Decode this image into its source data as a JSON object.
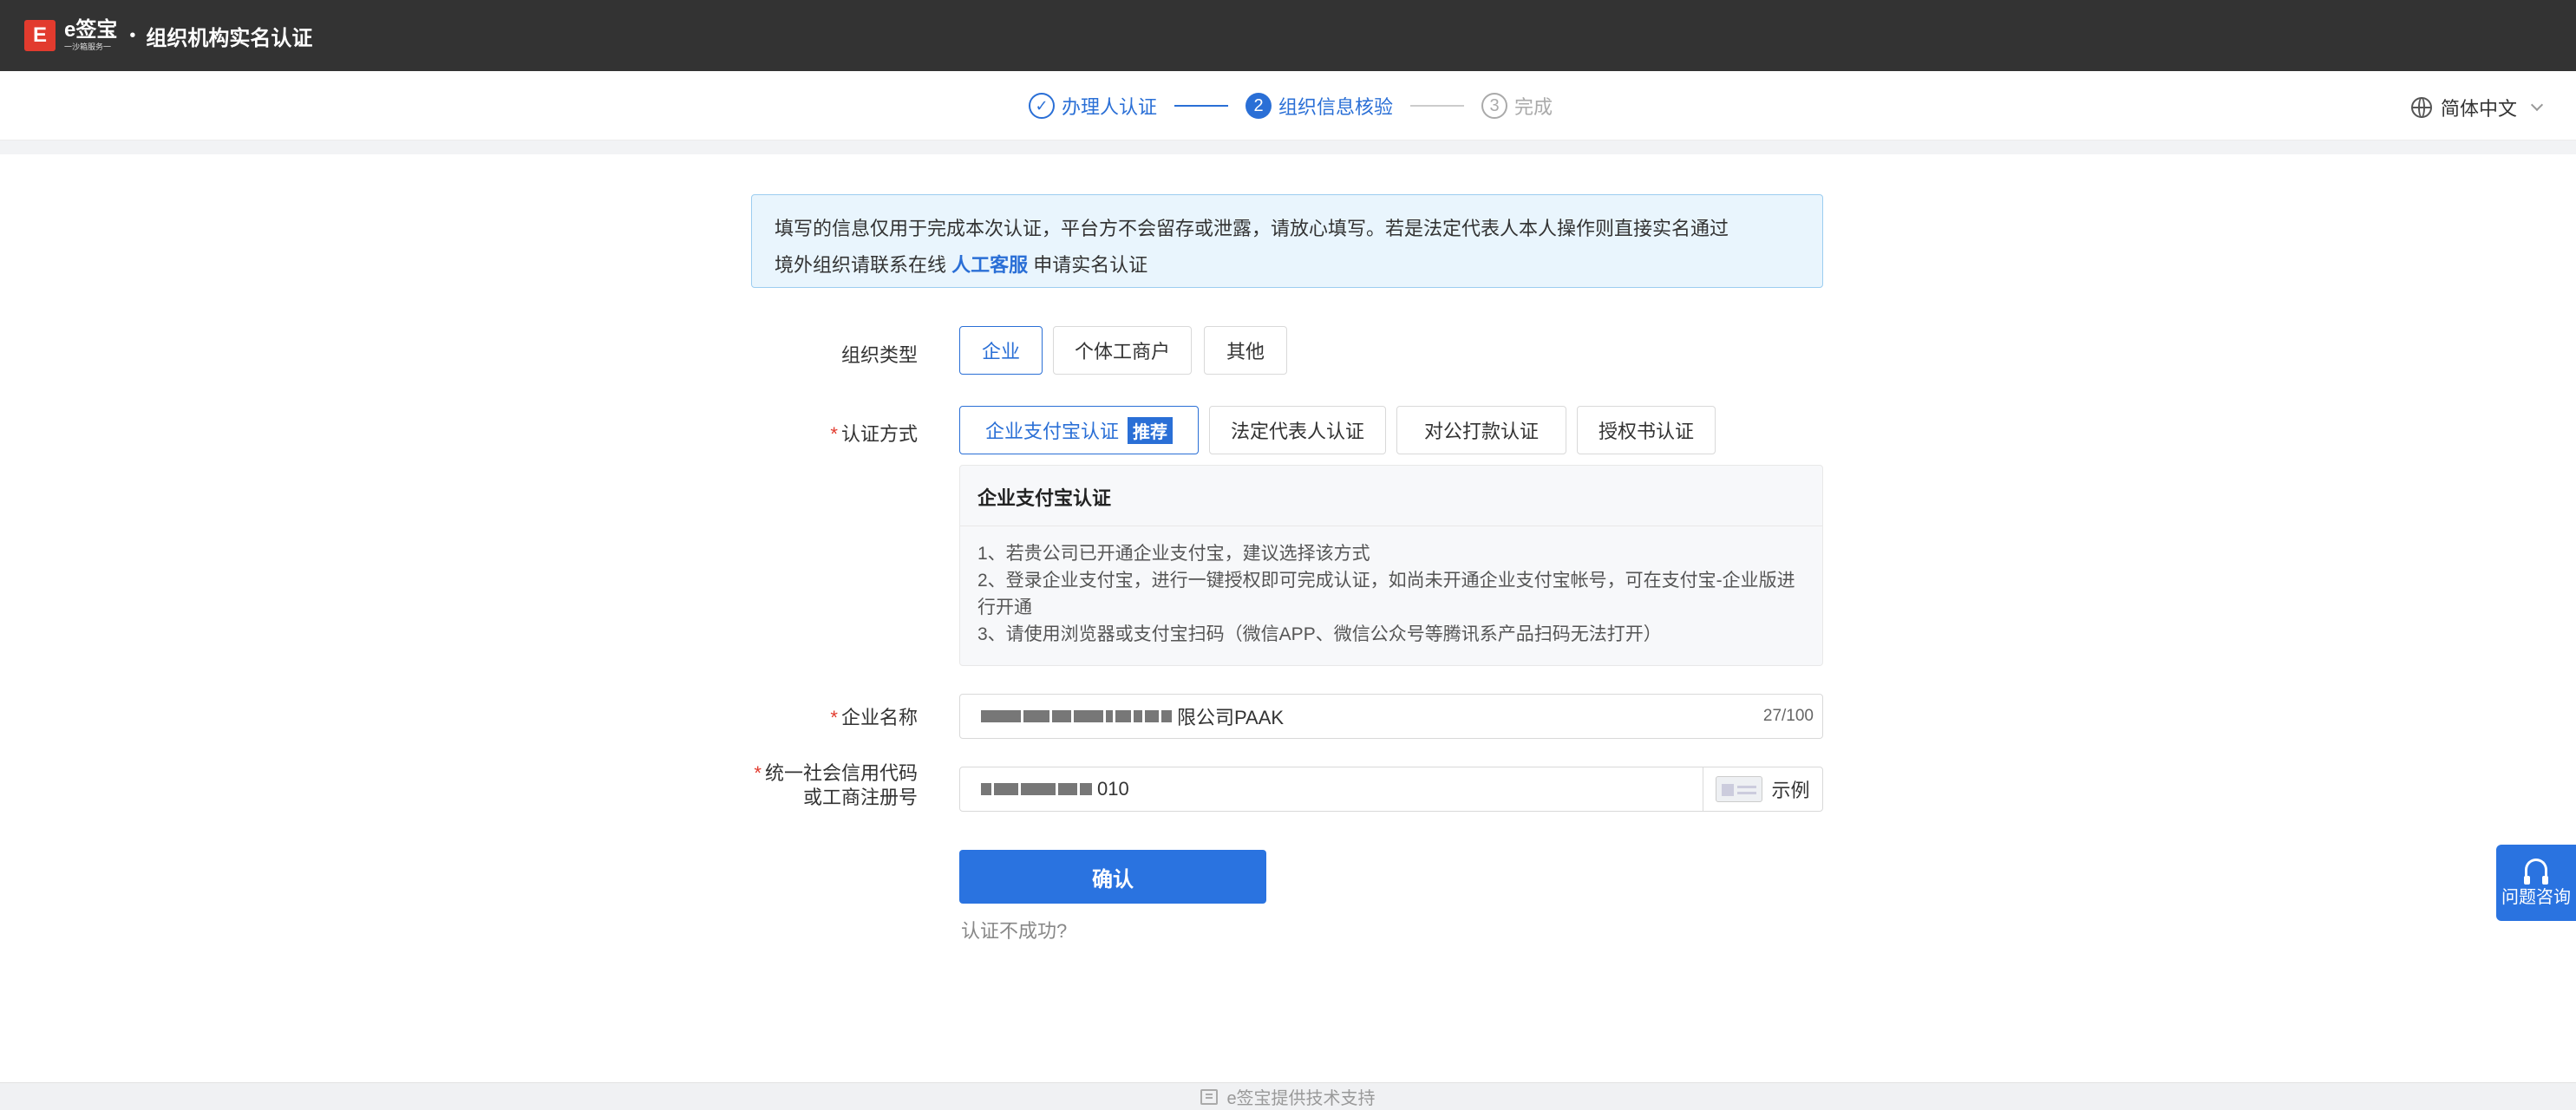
{
  "header": {
    "logo_mark": "E",
    "logo_name": "e签宝",
    "logo_sub": "一沙箱服务一",
    "separator": "•",
    "title": "组织机构实名认证"
  },
  "steps": [
    {
      "label": "办理人认证",
      "marker": "✓",
      "state": "done"
    },
    {
      "label": "组织信息核验",
      "marker": "2",
      "state": "active"
    },
    {
      "label": "完成",
      "marker": "3",
      "state": "todo"
    }
  ],
  "language": {
    "label": "简体中文"
  },
  "notice": {
    "line1": "填写的信息仅用于完成本次认证，平台方不会留存或泄露，请放心填写。若是法定代表人本人操作则直接实名通过",
    "line2_prefix": "境外组织请联系在线",
    "line2_link": "人工客服",
    "line2_suffix": "申请实名认证"
  },
  "org_type": {
    "label": "组织类型",
    "options": [
      "企业",
      "个体工商户",
      "其他"
    ],
    "selected": "企业"
  },
  "auth_method": {
    "label": "认证方式",
    "options": [
      "企业支付宝认证",
      "法定代表人认证",
      "对公打款认证",
      "授权书认证"
    ],
    "recommended_tag": "推荐",
    "selected": "企业支付宝认证"
  },
  "description": {
    "title": "企业支付宝认证",
    "lines": [
      "1、若贵公司已开通企业支付宝，建议选择该方式",
      "2、登录企业支付宝，进行一键授权即可完成认证，如尚未开通企业支付宝帐号，可在支付宝-企业版进行开通",
      "3、请使用浏览器或支付宝扫码（微信APP、微信公众号等腾讯系产品扫码无法打开）"
    ]
  },
  "company_name": {
    "label": "企业名称",
    "visible_value": "限公司PAAK",
    "counter": "27/100"
  },
  "credit_code": {
    "label_line1": "统一社会信用代码",
    "label_line2": "或工商注册号",
    "visible_value": "010",
    "example_label": "示例"
  },
  "confirm_button": "确认",
  "fail_link": "认证不成功?",
  "help_button": "问题咨询",
  "footer": "e签宝提供技术支持",
  "colors": {
    "primary": "#2a73e0",
    "topbar": "#333333",
    "notice_bg": "#e9f5fd",
    "required": "#e23b2e"
  }
}
